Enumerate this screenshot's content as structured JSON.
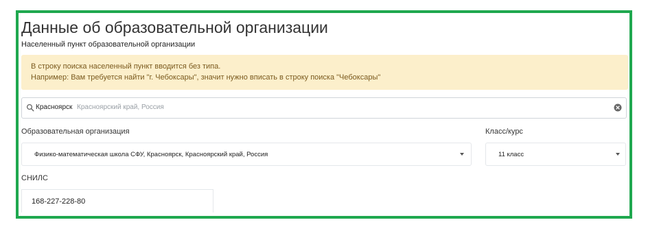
{
  "page": {
    "title": "Данные об образовательной организации",
    "subtitle": "Населенный пункт образовательной организации"
  },
  "alert": {
    "line1": "В строку поиска населенный пункт вводится без типа.",
    "line2": "Например: Вам требуется найти \"г. Чебоксары\", значит нужно вписать в строку поиска \"Чебоксары\""
  },
  "search": {
    "value": "Красноярск",
    "hint": "Красноярский край, Россия",
    "icon": "search-icon",
    "clear_icon": "clear-icon"
  },
  "organization": {
    "label": "Образовательная организация",
    "selected": "Физико-математическая школа СФУ, Красноярск, Красноярский край, Россия"
  },
  "grade": {
    "label": "Класс/курс",
    "selected": "11 класс"
  },
  "snils": {
    "label": "СНИЛС",
    "value": "168-227-228-80"
  },
  "colors": {
    "frame_border": "#1fa84f",
    "alert_background": "#fcefcb",
    "alert_text": "#7a5a1e"
  }
}
